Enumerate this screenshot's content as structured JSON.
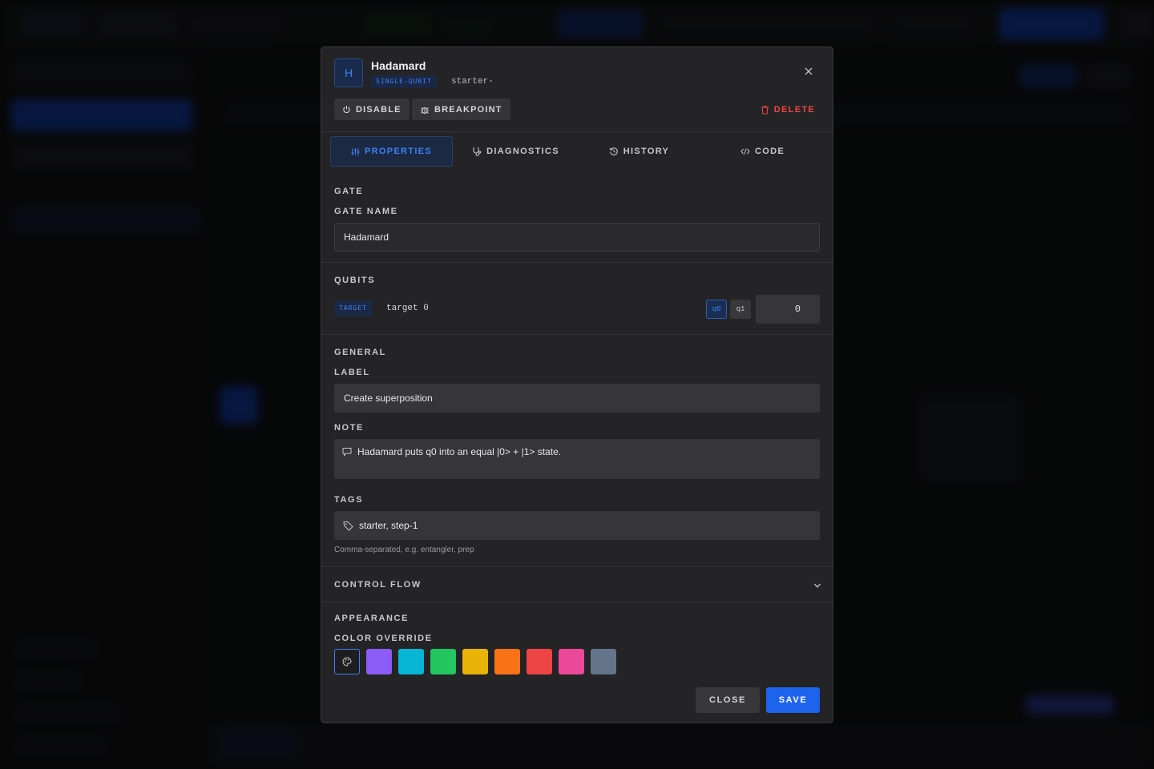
{
  "modal": {
    "gate_symbol": "H",
    "title": "Hadamard",
    "kind": "SINGLE-QUBIT",
    "id_text": "starter-",
    "actions": {
      "disable": "DISABLE",
      "breakpoint": "BREAKPOINT",
      "delete": "DELETE"
    },
    "tabs": [
      {
        "label": "PROPERTIES",
        "active": true
      },
      {
        "label": "DIAGNOSTICS",
        "active": false
      },
      {
        "label": "HISTORY",
        "active": false
      },
      {
        "label": "CODE",
        "active": false
      }
    ],
    "gate_section": {
      "heading": "GATE",
      "name_label": "GATE NAME",
      "name_value": "Hadamard"
    },
    "qubits_section": {
      "heading": "QUBITS",
      "role": "TARGET",
      "role_text": "target 0",
      "chips": [
        {
          "label": "q0",
          "selected": true
        },
        {
          "label": "q1",
          "selected": false
        }
      ],
      "index_value": "0"
    },
    "general_section": {
      "heading": "GENERAL",
      "label_label": "LABEL",
      "label_value": "Create superposition",
      "note_label": "NOTE",
      "note_value": "Hadamard puts q0 into an equal |0> + |1> state.",
      "tags_label": "TAGS",
      "tags_value": "starter, step-1",
      "tags_hint": "Comma-separated, e.g. entangler, prep"
    },
    "control_flow": {
      "heading": "CONTROL FLOW",
      "expanded": false
    },
    "appearance": {
      "heading": "APPEARANCE",
      "color_label": "COLOR OVERRIDE",
      "swatches": [
        "#8b5cf6",
        "#06b6d4",
        "#22c55e",
        "#eab308",
        "#f97316",
        "#ef4444",
        "#ec4899",
        "#64748b"
      ]
    },
    "footer": {
      "close": "CLOSE",
      "save": "SAVE"
    }
  }
}
